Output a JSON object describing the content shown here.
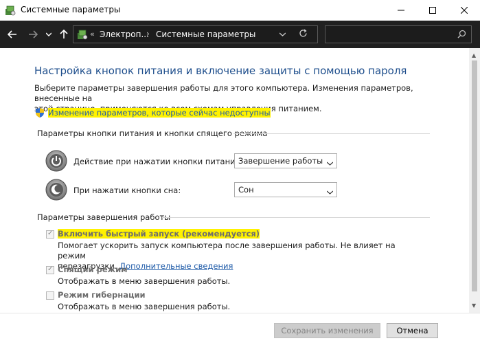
{
  "window": {
    "title": "Системные параметры"
  },
  "nav": {
    "breadcrumb_prefix": "«",
    "breadcrumb_1": "Электроп...",
    "breadcrumb_sep": "›",
    "breadcrumb_2": "Системные параметры",
    "search_placeholder": ""
  },
  "page": {
    "title": "Настройка кнопок питания и включение защиты с помощью пароля",
    "description_1": "Выберите параметры завершения работы для этого компьютера. Изменения параметров, внесенные на",
    "description_2": "этой странице, применяются ко всем схемам управления питанием.",
    "change_link": "Изменение параметров, которые сейчас недоступны"
  },
  "power_buttons": {
    "section_label": "Параметры кнопки питания и кнопки спящего режима",
    "rows": [
      {
        "label": "Действие при нажатии кнопки питания:",
        "value": "Завершение работы"
      },
      {
        "label": "При нажатии кнопки сна:",
        "value": "Сон"
      }
    ]
  },
  "shutdown": {
    "section_label": "Параметры завершения работы",
    "options": [
      {
        "label": "Включить быстрый запуск (рекомендуется)",
        "checked": true,
        "desc_1": "Помогает ускорить запуск компьютера после завершения работы. Не влияет на режим",
        "desc_2": "перезагрузки.",
        "link": "Дополнительные сведения"
      },
      {
        "label": "Спящий режим",
        "checked": true,
        "desc_1": "Отображать в меню завершения работы."
      },
      {
        "label": "Режим гибернации",
        "checked": false,
        "desc_1": "Отображать в меню завершения работы."
      }
    ]
  },
  "footer": {
    "save_label": "Сохранить изменения",
    "cancel_label": "Отмена"
  },
  "colors": {
    "highlight": "#fff200",
    "title_blue": "#1e4e8c",
    "link_blue": "#1e5aa8",
    "nav_dark": "#202020"
  }
}
